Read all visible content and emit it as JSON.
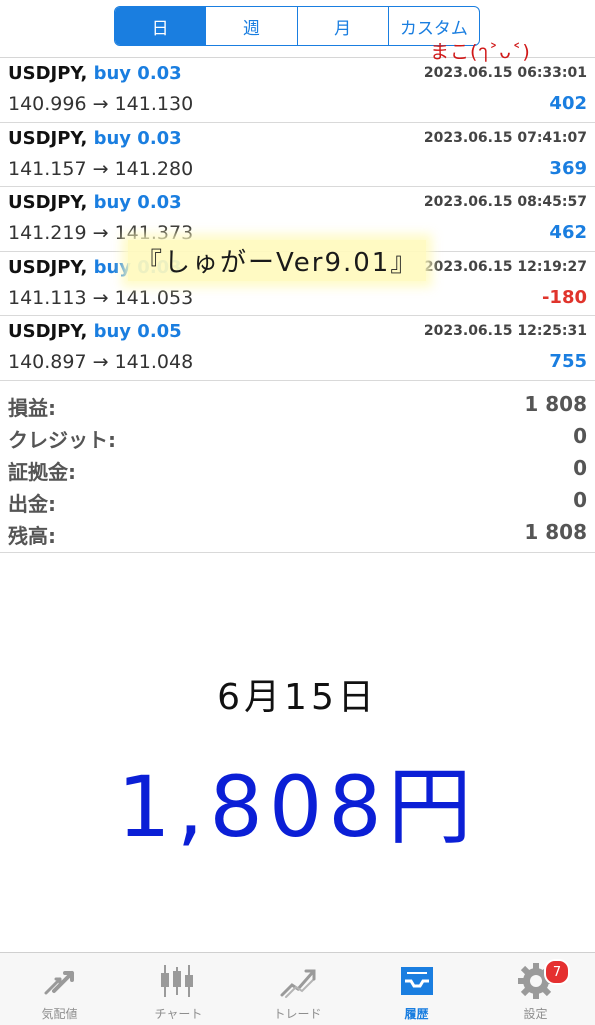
{
  "segments": [
    "日",
    "週",
    "月",
    "カスタム"
  ],
  "trades": [
    {
      "symbol": "USDJPY,",
      "side": "buy 0.03",
      "time": "2023.06.15 06:33:01",
      "open": "140.996",
      "close": "141.130",
      "profit": "402"
    },
    {
      "symbol": "USDJPY,",
      "side": "buy 0.03",
      "time": "2023.06.15 07:41:07",
      "open": "141.157",
      "close": "141.280",
      "profit": "369"
    },
    {
      "symbol": "USDJPY,",
      "side": "buy 0.03",
      "time": "2023.06.15 08:45:57",
      "open": "141.219",
      "close": "141.373",
      "profit": "462"
    },
    {
      "symbol": "USDJPY,",
      "side": "buy 0.03",
      "time": "2023.06.15 12:19:27",
      "open": "141.113",
      "close": "141.053",
      "profit": "-180"
    },
    {
      "symbol": "USDJPY,",
      "side": "buy 0.05",
      "time": "2023.06.15 12:25:31",
      "open": "140.897",
      "close": "141.048",
      "profit": "755"
    }
  ],
  "arrow": "→",
  "summary": [
    {
      "label": "損益:",
      "value": "1 808"
    },
    {
      "label": "クレジット:",
      "value": "0"
    },
    {
      "label": "証拠金:",
      "value": "0"
    },
    {
      "label": "出金:",
      "value": "0"
    },
    {
      "label": "残高:",
      "value": "1 808"
    }
  ],
  "notes": {
    "mako": "まこ(ๅ˃ᴗ˂)",
    "version": "『しゅがーVer9.01』",
    "date": "6月15日",
    "amount": "1,808円"
  },
  "tabs": [
    {
      "label": "気配値",
      "icon": "quotes-icon"
    },
    {
      "label": "チャート",
      "icon": "chart-icon"
    },
    {
      "label": "トレード",
      "icon": "trade-icon"
    },
    {
      "label": "履歴",
      "icon": "history-icon"
    },
    {
      "label": "設定",
      "icon": "settings-icon",
      "badge": "7"
    }
  ],
  "colors": {
    "accent": "#1a7ee0",
    "negative": "#e0342c",
    "note_red": "#d01818",
    "note_blue": "#0b1fd6"
  }
}
